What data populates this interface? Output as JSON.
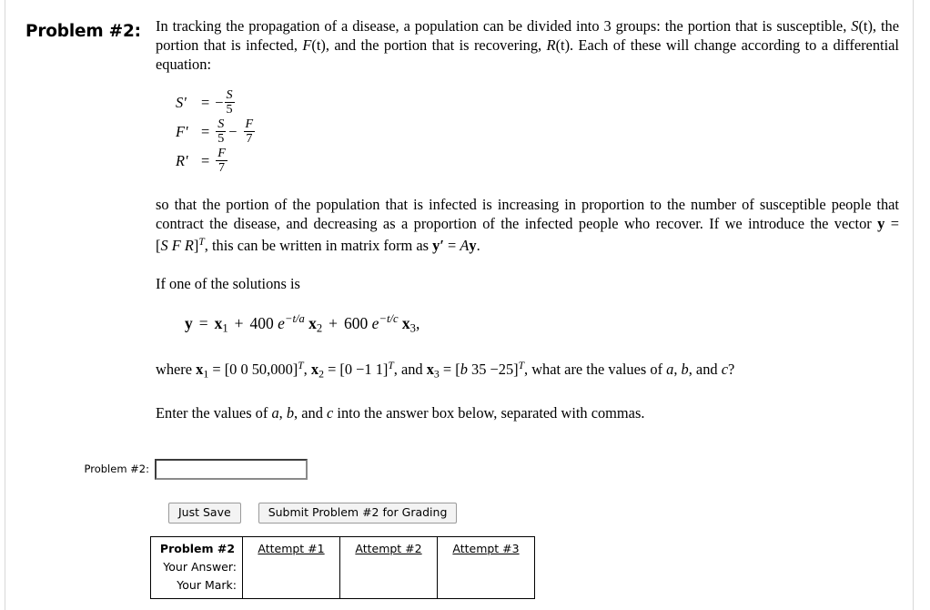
{
  "page": {
    "rules_color": "#d8d8d8"
  },
  "problem": {
    "title": "Problem #2:",
    "intro_line1": "In tracking the propagation of a disease, a population can be divided into 3 groups: the portion that is susceptible,",
    "intro_line2_a": "S",
    "intro_line2_b": "(t), the portion that is infected, ",
    "intro_line2_c": "F",
    "intro_line2_d": "(t), and the portion that is recovering, ",
    "intro_line2_e": "R",
    "intro_line2_f": "(t). Each of these will change according to a differential equation:",
    "intro_full": "In tracking the propagation of a disease, a population can be divided into 3 groups: the portion that is susceptible, S(t), the portion that is infected, F(t), and the portion that is recovering, R(t). Each of these will change according to a differential equation:",
    "equations": [
      {
        "lhs": "S'",
        "rhs": "= -S/5"
      },
      {
        "lhs": "F'",
        "rhs": "= S/5 - F/7"
      },
      {
        "lhs": "R'",
        "rhs": "= F/7"
      }
    ],
    "eq1_lhs": "S'",
    "eq1_sign": "−",
    "eq1_num": "S",
    "eq1_den": "5",
    "eq2_lhs": "F'",
    "eq2_num1": "S",
    "eq2_den1": "5",
    "eq2_op": "−",
    "eq2_num2": "F",
    "eq2_den2": "7",
    "eq3_lhs": "R'",
    "eq3_num": "F",
    "eq3_den": "7",
    "equals": "=",
    "body_paragraph": "so that the portion of the population that is infected is increasing in proportion to the number of susceptible people that contract the disease, and decreasing as a proportion of the infected people who recover. If we introduce the vector y = [S F R]T, this can be written in matrix form as y' = Ay.",
    "body_p2_part1": "so that the portion of the population that is infected is increasing in proportion to the number of susceptible people that contract the disease, and decreasing as a proportion of the infected people who recover. If we introduce the vector ",
    "body_p2_vec_y": "y",
    "body_p2_part2": " = [",
    "body_p2_S": "S",
    "body_p2_F": "F",
    "body_p2_R": "R",
    "body_p2_part3": "]",
    "body_p2_T": "T",
    "body_p2_part4": ", this can be written in matrix form as ",
    "body_p2_ydash": "y′",
    "body_p2_part5": " = ",
    "body_p2_A": "A",
    "body_p2_yend": "y",
    "body_p2_period": ".",
    "if_solution_line": "If one of the solutions is",
    "solution": {
      "y": "y",
      "equals": "=",
      "x1": "x",
      "x1_sub": "1",
      "plus1": "+",
      "coef1": "400",
      "e1": "e",
      "exp1": "−t/a",
      "x2": "x",
      "x2_sub": "2",
      "plus2": "+",
      "coef2": "600",
      "e2": "e",
      "exp2": "−t/c",
      "x3": "x",
      "x3_sub": "3",
      "comma": ","
    },
    "where_line": {
      "where": "where ",
      "x1": "x",
      "x1_sub": "1",
      "eq1": " = [0  0  50,000]",
      "T1": "T",
      "sep1": ", ",
      "x2": "x",
      "x2_sub": "2",
      "eq2": " = [0 −1  1]",
      "T2": "T",
      "sep2": ", and ",
      "x3": "x",
      "x3_sub": "3",
      "eq3": " = [",
      "b_italic": "b",
      "eq3b": "  35  −25]",
      "T3": "T",
      "tail1": ", what are the values of ",
      "a_italic": "a",
      "tail2": ", ",
      "b_italic2": "b",
      "tail3": ", and ",
      "c_italic": "c",
      "tail4": "?"
    },
    "instruction_line": "Enter the values of a, b, and c into the answer box below, separated with commas.",
    "instruction_p1": "Enter the values of ",
    "instruction_a": "a",
    "instruction_p2": ", ",
    "instruction_b": "b",
    "instruction_p3": ", and ",
    "instruction_c": "c",
    "instruction_p4": " into the answer box below, separated with commas."
  },
  "answer": {
    "label": "Problem #2:",
    "value": "",
    "placeholder": ""
  },
  "buttons": {
    "just_save": "Just Save",
    "submit": "Submit Problem #2 for Grading"
  },
  "attempts_table": {
    "row_labels": [
      "Problem #2",
      "Your Answer:",
      "Your Mark:"
    ],
    "columns": [
      "Attempt #1",
      "Attempt #2",
      "Attempt #3"
    ],
    "cells": [
      [
        "",
        "",
        ""
      ],
      [
        "",
        "",
        ""
      ]
    ]
  }
}
